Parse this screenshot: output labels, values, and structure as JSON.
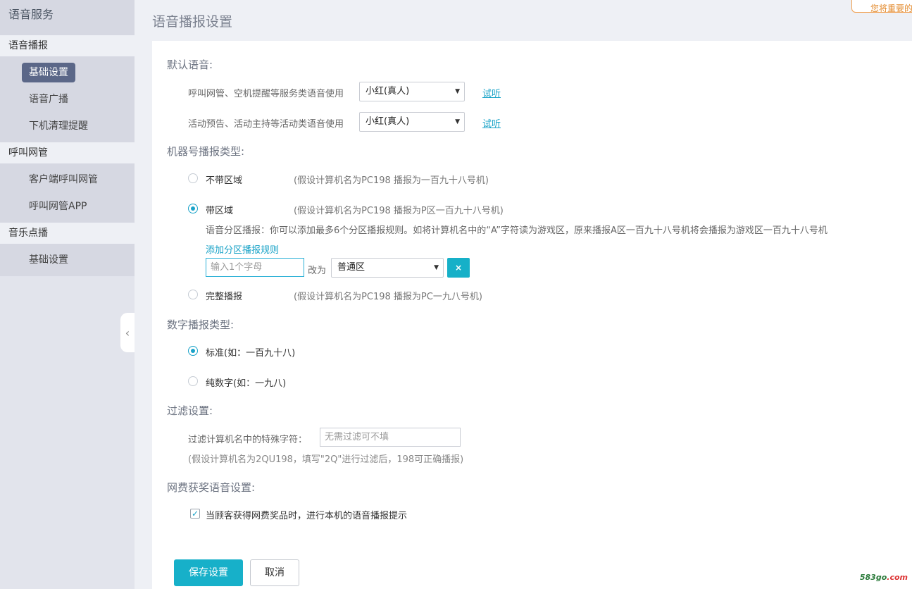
{
  "sidebar": {
    "title": "语音服务",
    "groups": [
      {
        "label": "语音播报",
        "items": [
          "基础设置",
          "语音广播",
          "下机清理提醒"
        ]
      },
      {
        "label": "呼叫网管",
        "items": [
          "客户端呼叫网管",
          "呼叫网管APP"
        ]
      },
      {
        "label": "音乐点播",
        "items": [
          "基础设置"
        ]
      }
    ],
    "collapse_glyph": "‹"
  },
  "header": {
    "title": "语音播报设置",
    "popup_text": "您将重要的"
  },
  "default_voice": {
    "heading": "默认语音:",
    "rows": [
      {
        "label": "呼叫网管、空机提醒等服务类语音使用",
        "value": "小红(真人)",
        "link": "试听"
      },
      {
        "label": "活动预告、活动主持等活动类语音使用",
        "value": "小红(真人)",
        "link": "试听"
      }
    ]
  },
  "machine_type": {
    "heading": "机器号播报类型:",
    "options": [
      {
        "label": "不带区域",
        "note": "(假设计算机名为PC198 播报为一百九十八号机)",
        "checked": false
      },
      {
        "label": "带区域",
        "note": "(假设计算机名为PC198 播报为P区一百九十八号机)",
        "checked": true
      },
      {
        "label": "完整播报",
        "note": "(假设计算机名为PC198 播报为PC一九八号机)",
        "checked": false
      }
    ],
    "zone_desc": "语音分区播报：你可以添加最多6个分区播报规则。如将计算机名中的“A”字符读为游戏区，原来播报A区一百九十八号机将会播报为游戏区一百九十八号机",
    "add_rule_link": "添加分区播报规则",
    "rule": {
      "letter_placeholder": "输入1个字母",
      "change_to": "改为",
      "zone_value": "普通区",
      "delete_glyph": "×"
    }
  },
  "number_type": {
    "heading": "数字播报类型:",
    "options": [
      {
        "label": "标准(如：一百九十八)",
        "checked": true
      },
      {
        "label": "纯数字(如：一九八)",
        "checked": false
      }
    ]
  },
  "filter": {
    "heading": "过滤设置:",
    "label": "过滤计算机名中的特殊字符：",
    "placeholder": "无需过滤可不填",
    "hint": "(假设计算机名为2QU198，填写\"2Q\"进行过滤后，198可正确播报)"
  },
  "prize": {
    "heading": "网费获奖语音设置:",
    "checkbox_label": "当顾客获得网费奖品时，进行本机的语音播报提示",
    "checked": true
  },
  "buttons": {
    "save": "保存设置",
    "cancel": "取消"
  },
  "watermark": {
    "main": "583go",
    "suffix": ".com"
  }
}
